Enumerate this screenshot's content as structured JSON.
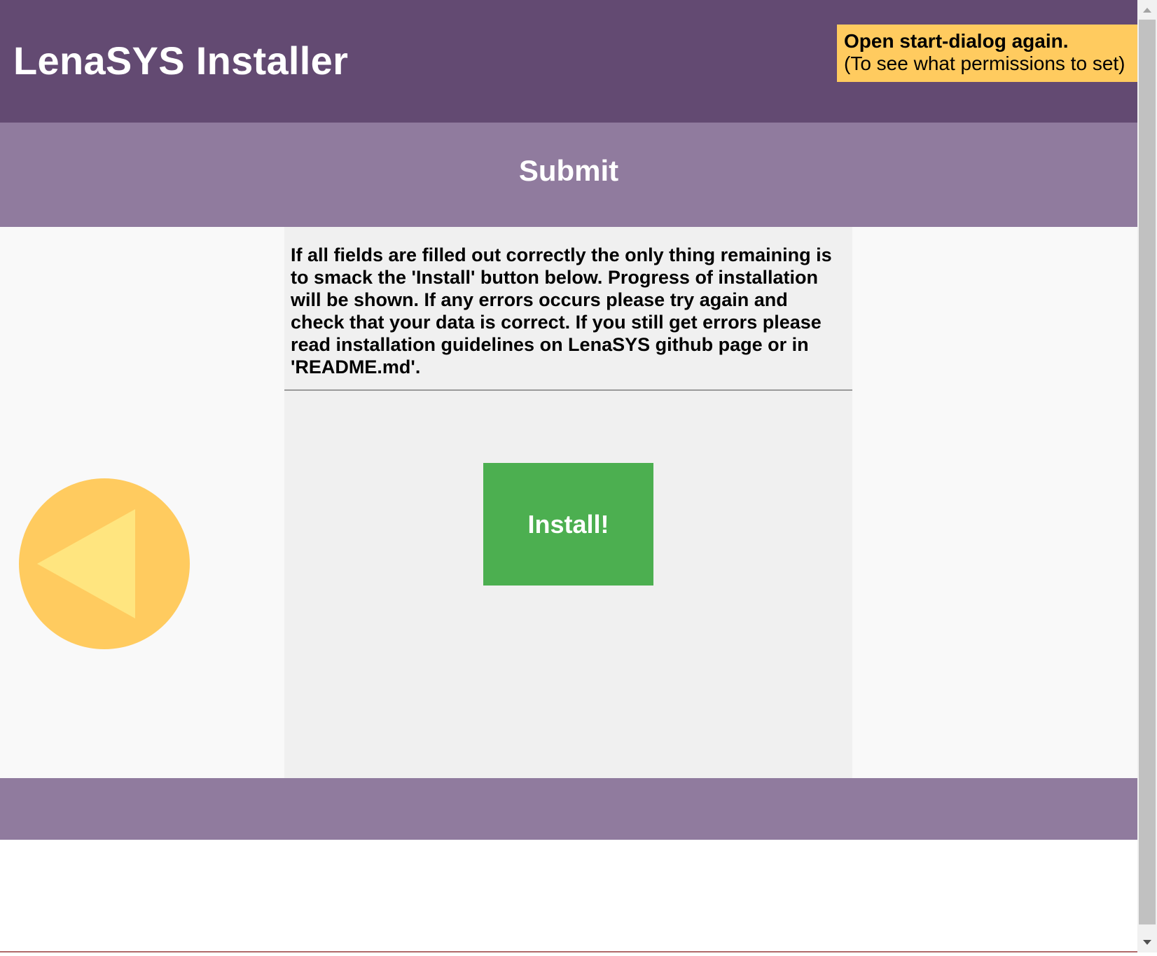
{
  "header": {
    "title": "LenaSYS Installer",
    "start_dialog": {
      "title": "Open start-dialog again.",
      "subtitle": "(To see what permissions to set)"
    }
  },
  "step": {
    "title": "Submit",
    "instructions": "If all fields are filled out correctly the only thing remaining is to smack the 'Install' button below. Progress of installation will be shown. If any errors occurs please try again and check that your data is correct. If you still get errors please read installation guidelines on LenaSYS github page or in 'README.md'.",
    "install_label": "Install!"
  },
  "navigation": {
    "back_icon": "triangle-left-icon"
  },
  "colors": {
    "header": "#634a72",
    "subheader": "#907b9e",
    "accent": "#ffcb5f",
    "arrow": "#ffe57f",
    "install": "#4caf50",
    "panel": "#f0f0f0"
  }
}
